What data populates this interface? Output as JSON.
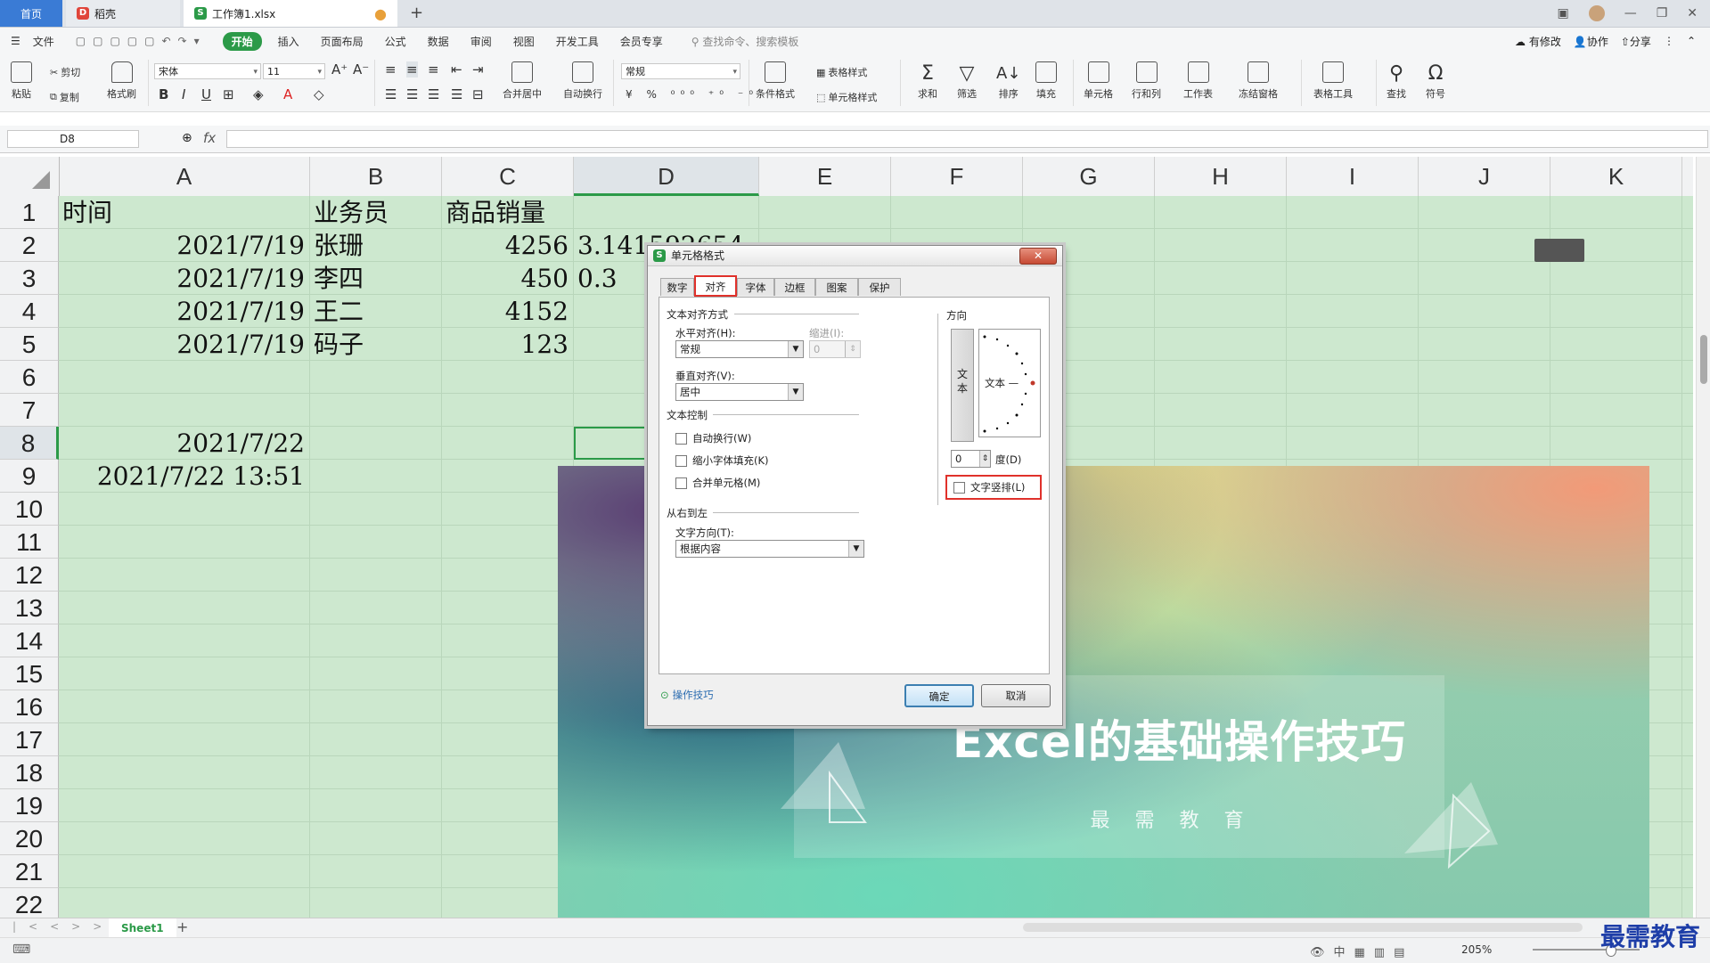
{
  "tabs": {
    "home": "首页",
    "daoke": "稻壳",
    "file": "工作簿1.xlsx"
  },
  "menu": {
    "items": [
      "文件",
      "开始",
      "插入",
      "页面布局",
      "公式",
      "数据",
      "审阅",
      "视图",
      "开发工具",
      "会员专享"
    ],
    "search": "查找命令、搜索模板",
    "right": [
      "有修改",
      "协作",
      "分享"
    ]
  },
  "ribbon": {
    "paste": "粘贴",
    "cut": "剪切",
    "copy": "复制",
    "format_painter": "格式刷",
    "font_name": "宋体",
    "font_size": "11",
    "merge_center": "合并居中",
    "wrap": "自动换行",
    "number_format": "常规",
    "cond_format": "条件格式",
    "table_style": "表格样式",
    "cell_style": "单元格样式",
    "sum": "求和",
    "filter": "筛选",
    "sort": "排序",
    "fill": "填充",
    "cells": "单元格",
    "rowcol": "行和列",
    "worksheet": "工作表",
    "freeze": "冻结窗格",
    "table_tools": "表格工具",
    "find": "查找",
    "symbol": "符号"
  },
  "namebox": "D8",
  "fx": "fx",
  "columns": [
    "A",
    "B",
    "C",
    "D",
    "E",
    "F",
    "G",
    "H",
    "I",
    "J",
    "K"
  ],
  "rows": [
    "1",
    "2",
    "3",
    "4",
    "5",
    "6",
    "7",
    "8",
    "9",
    "10",
    "11",
    "12",
    "13",
    "14",
    "15",
    "16",
    "17",
    "18",
    "19",
    "20",
    "21",
    "22"
  ],
  "cells": {
    "A1": "时间",
    "B1": "业务员",
    "C1": "商品销量",
    "A2": "2021/7/19",
    "B2": "张珊",
    "C2": "4256",
    "D2": "3.141592654",
    "A3": "2021/7/19",
    "B3": "李四",
    "C3": "450",
    "D3": "0.3",
    "A4": "2021/7/19",
    "B4": "王二",
    "C4": "4152",
    "A5": "2021/7/19",
    "B5": "码子",
    "C5": "123",
    "A8": "2021/7/22",
    "A9": "2021/7/22  13:51"
  },
  "dialog": {
    "title": "单元格格式",
    "tabs": [
      "数字",
      "对齐",
      "字体",
      "边框",
      "图案",
      "保护"
    ],
    "active_tab": "对齐",
    "text_align_group": "文本对齐方式",
    "h_align_label": "水平对齐(H):",
    "h_align_value": "常规",
    "indent_label": "缩进(I):",
    "indent_value": "0",
    "v_align_label": "垂直对齐(V):",
    "v_align_value": "居中",
    "text_control_group": "文本控制",
    "wrap_text": "自动换行(W)",
    "shrink_fit": "缩小字体填充(K)",
    "merge_cells": "合并单元格(M)",
    "rtl_group": "从右到左",
    "text_dir_label": "文字方向(T):",
    "text_dir_value": "根据内容",
    "orientation_group": "方向",
    "vertical_text": "文\n本",
    "dial_text": "文本 —",
    "degree_value": "0",
    "degree_label": "度(D)",
    "vertical_arrange": "文字竖排(L)",
    "tips": "操作技巧",
    "ok": "确定",
    "cancel": "取消"
  },
  "banner": {
    "title": "Excel的基础操作技巧",
    "subtitle": "最需教育"
  },
  "sheet": {
    "name": "Sheet1"
  },
  "status": {
    "zoom": "205%"
  },
  "watermark": "最需教育"
}
